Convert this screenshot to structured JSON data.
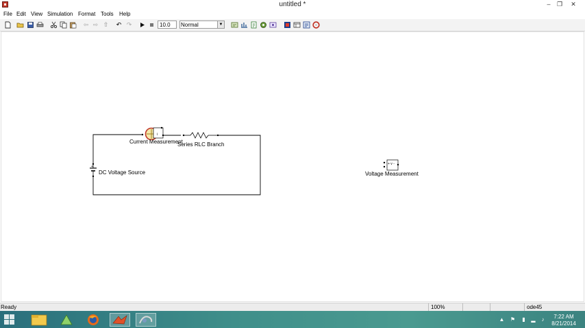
{
  "window": {
    "title": "untitled *",
    "minimize": "–",
    "maximize": "❐",
    "close": "✕"
  },
  "menu": [
    "File",
    "Edit",
    "View",
    "Simulation",
    "Format",
    "Tools",
    "Help"
  ],
  "toolbar": {
    "stop_time": "10.0",
    "sim_mode": "Normal"
  },
  "blocks": {
    "current_measurement": "Current Measurement",
    "series_rlc": "Series RLC Branch",
    "dc_source": "DC Voltage Source",
    "voltage_measurement": "Voltage Measurement",
    "voltage_symbol": "+ v -"
  },
  "status": {
    "message": "Ready",
    "zoom": "100%",
    "solver": "ode45"
  },
  "taskbar": {
    "time": "7:22 AM",
    "date": "8/21/2014"
  }
}
